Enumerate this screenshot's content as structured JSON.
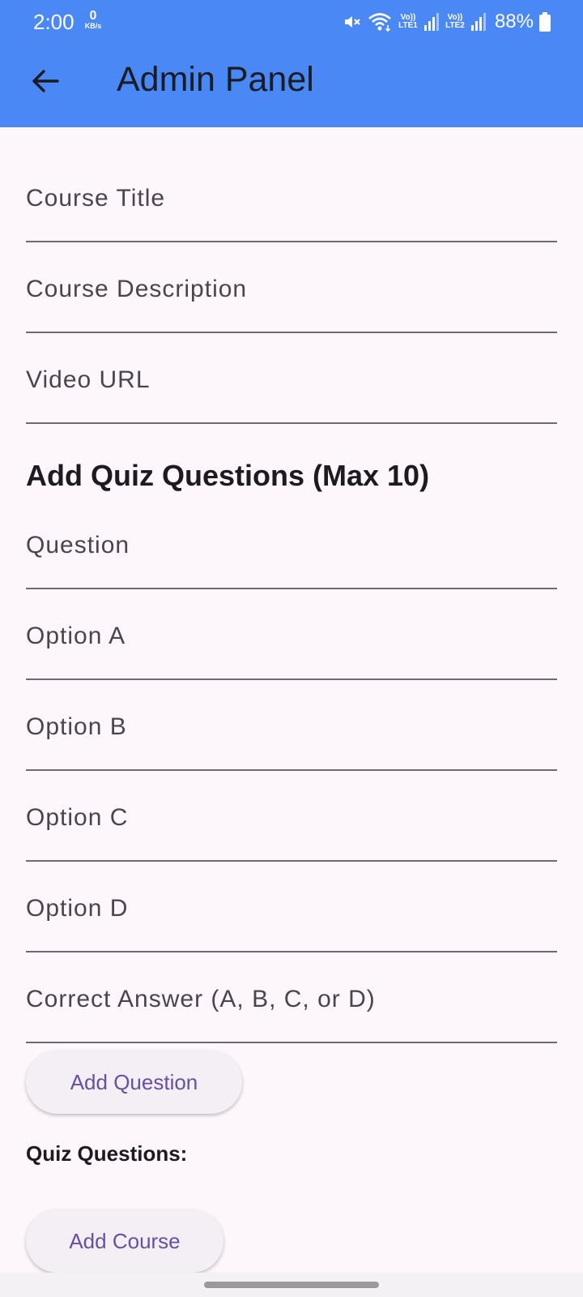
{
  "status_bar": {
    "time": "2:00",
    "net_speed_value": "0",
    "net_speed_unit": "KB/s",
    "sim1_label": "Vo)) LTE1",
    "sim2_label": "Vo)) LTE2",
    "battery": "88%",
    "icons": [
      "mute-icon",
      "wifi-icon",
      "signal-icon",
      "battery-icon"
    ]
  },
  "app_bar": {
    "title": "Admin Panel",
    "back_icon": "arrow-left-icon",
    "color": "#4a88f6"
  },
  "course_form": {
    "title_placeholder": "Course Title",
    "description_placeholder": "Course Description",
    "video_url_placeholder": "Video URL"
  },
  "quiz_section": {
    "heading": "Add Quiz Questions (Max 10)",
    "question_placeholder": "Question",
    "option_a_placeholder": "Option A",
    "option_b_placeholder": "Option B",
    "option_c_placeholder": "Option C",
    "option_d_placeholder": "Option D",
    "correct_answer_placeholder": "Correct Answer (A, B, C, or D)",
    "add_question_label": "Add Question",
    "list_heading": "Quiz Questions:"
  },
  "actions": {
    "add_course_label": "Add Course",
    "accent": "#6750a4"
  }
}
